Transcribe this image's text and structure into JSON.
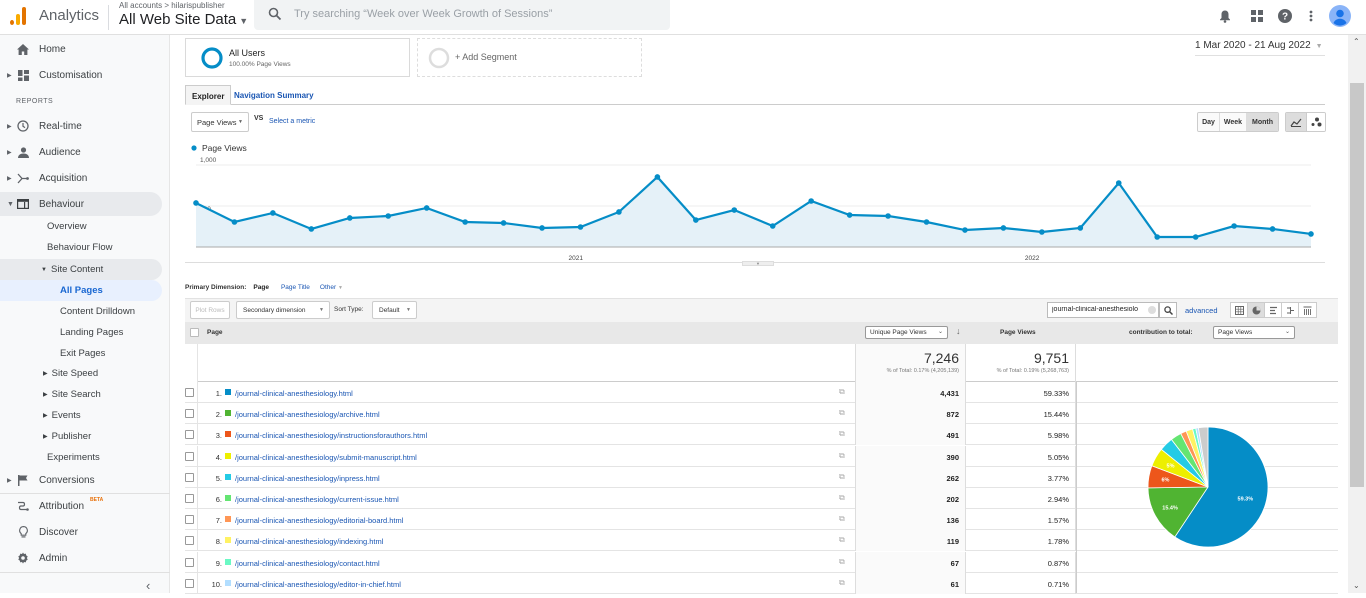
{
  "topbar": {
    "brand": "Analytics",
    "breadcrumb": "All accounts > hilarispublisher",
    "property": "All Web Site Data",
    "search_placeholder": "Try searching “Week over Week Growth of Sessions”",
    "icons": [
      "bell-icon",
      "apps-grid-icon",
      "help-icon",
      "more-vert-icon",
      "account-avatar-icon"
    ]
  },
  "sidebar": {
    "top_items": [
      {
        "label": "Home",
        "icon": "home-icon"
      },
      {
        "label": "Customisation",
        "icon": "dashboard-icon"
      }
    ],
    "section_label": "REPORTS",
    "report_items": [
      {
        "label": "Real-time",
        "icon": "clock-icon"
      },
      {
        "label": "Audience",
        "icon": "person-icon"
      },
      {
        "label": "Acquisition",
        "icon": "acquisition-icon"
      },
      {
        "label": "Behaviour",
        "icon": "behaviour-icon"
      }
    ],
    "behaviour_children": [
      "Overview",
      "Behaviour Flow",
      "Site Content"
    ],
    "site_content_children": [
      "All Pages",
      "Content Drilldown",
      "Landing Pages",
      "Exit Pages"
    ],
    "behaviour_more": [
      "Site Speed",
      "Site Search",
      "Events",
      "Publisher",
      "Experiments"
    ],
    "bottom_items": [
      {
        "label": "Conversions",
        "icon": "flag-icon"
      },
      {
        "label": "Attribution",
        "icon": "attribution-icon",
        "badge": "BETA"
      },
      {
        "label": "Discover",
        "icon": "lightbulb-icon"
      },
      {
        "label": "Admin",
        "icon": "gear-icon"
      }
    ]
  },
  "segments": {
    "active_name": "All Users",
    "active_sub": "100.00% Page Views",
    "add_label": "+ Add Segment"
  },
  "date_range": "1 Mar 2020 - 21 Aug 2022",
  "tabs": [
    "Explorer",
    "Navigation Summary"
  ],
  "metric_select": "Page Views",
  "vs_label": "VS",
  "select_metric": "Select a metric",
  "granularity": [
    "Day",
    "Week",
    "Month"
  ],
  "granularity_selected": "Month",
  "chart_data": {
    "type": "area",
    "legend": "Page Views",
    "y_ticks": [
      "1,000",
      "500"
    ],
    "ylim": [
      0,
      1000
    ],
    "x_labels": [
      {
        "label": "2021",
        "index": 10
      },
      {
        "label": "2022",
        "index": 22
      }
    ],
    "x": [
      "Mar 2020",
      "Apr 2020",
      "May 2020",
      "Jun 2020",
      "Jul 2020",
      "Aug 2020",
      "Sep 2020",
      "Oct 2020",
      "Nov 2020",
      "Dec 2020",
      "Jan 2021",
      "Feb 2021",
      "Mar 2021",
      "Apr 2021",
      "May 2021",
      "Jun 2021",
      "Jul 2021",
      "Aug 2021",
      "Sep 2021",
      "Oct 2021",
      "Nov 2021",
      "Dec 2021",
      "Jan 2022",
      "Feb 2022",
      "Mar 2022",
      "Apr 2022",
      "May 2022",
      "Jun 2022",
      "Jul 2022",
      "Aug 2022"
    ],
    "values": [
      537,
      305,
      415,
      220,
      354,
      378,
      476,
      305,
      293,
      232,
      244,
      427,
      854,
      329,
      451,
      256,
      561,
      390,
      378,
      305,
      207,
      232,
      183,
      232,
      780,
      122,
      122,
      256,
      220,
      159
    ],
    "color": "#058dc7",
    "fill": "#e5f1f8"
  },
  "table_controls": {
    "primary_dimension_label": "Primary Dimension:",
    "primary_dimension_options": [
      "Page",
      "Page Title",
      "Other"
    ],
    "plot_rows": "Plot Rows",
    "secondary_dimension": "Secondary dimension",
    "sort_type_label": "Sort Type:",
    "sort_type": "Default",
    "filter_value": "journal-clinical-anesthesiolo",
    "advanced": "advanced"
  },
  "table": {
    "col_page": "Page",
    "col_unique": "Unique Page Views",
    "col_pageviews": "Page Views",
    "contribution_label": "contribution to total:",
    "contribution_select": "Page Views",
    "total_unique": "7,246",
    "total_unique_sub": "% of Total: 0.17% (4,205,139)",
    "total_pv": "9,751",
    "total_pv_sub": "% of Total: 0.19% (5,268,763)",
    "rows": [
      {
        "n": "1.",
        "page": "/journal-clinical-anesthesiology.html",
        "unique": "4,431",
        "pct": "59.33%",
        "color": "#058dc7"
      },
      {
        "n": "2.",
        "page": "/journal-clinical-anesthesiology/archive.html",
        "unique": "872",
        "pct": "15.44%",
        "color": "#50b432"
      },
      {
        "n": "3.",
        "page": "/journal-clinical-anesthesiology/instructionsforauthors.html",
        "unique": "491",
        "pct": "5.98%",
        "color": "#ed561b"
      },
      {
        "n": "4.",
        "page": "/journal-clinical-anesthesiology/submit-manuscript.html",
        "unique": "390",
        "pct": "5.05%",
        "color": "#edef00"
      },
      {
        "n": "5.",
        "page": "/journal-clinical-anesthesiology/inpress.html",
        "unique": "262",
        "pct": "3.77%",
        "color": "#24cbe5"
      },
      {
        "n": "6.",
        "page": "/journal-clinical-anesthesiology/current-issue.html",
        "unique": "202",
        "pct": "2.94%",
        "color": "#64e572"
      },
      {
        "n": "7.",
        "page": "/journal-clinical-anesthesiology/editorial-board.html",
        "unique": "136",
        "pct": "1.57%",
        "color": "#ff9655"
      },
      {
        "n": "8.",
        "page": "/journal-clinical-anesthesiology/indexing.html",
        "unique": "119",
        "pct": "1.78%",
        "color": "#fff263"
      },
      {
        "n": "9.",
        "page": "/journal-clinical-anesthesiology/contact.html",
        "unique": "67",
        "pct": "0.87%",
        "color": "#6af9c4"
      },
      {
        "n": "10.",
        "page": "/journal-clinical-anesthesiology/editor-in-chief.html",
        "unique": "61",
        "pct": "0.71%",
        "color": "#b2deff"
      }
    ],
    "pie_other_pct": 2.56,
    "pie_other_color": "#cccccc",
    "pie_labels": [
      "59.3%",
      "15.4%",
      "6%",
      "5%"
    ]
  }
}
